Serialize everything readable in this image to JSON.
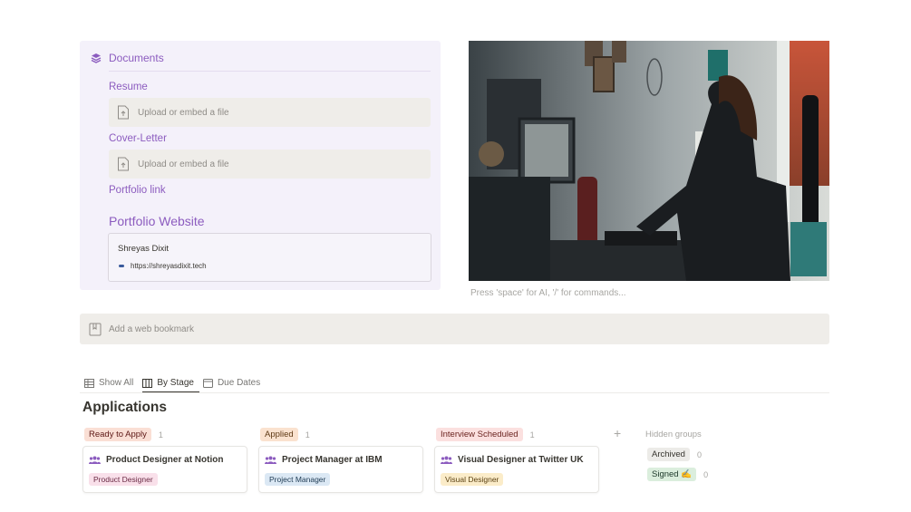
{
  "documents": {
    "title": "Documents",
    "resume_label": "Resume",
    "resume_upload": "Upload or embed a file",
    "cover_label": "Cover-Letter",
    "cover_upload": "Upload or embed a file",
    "portfolio_link_label": "Portfolio link",
    "portfolio_website_title": "Portfolio Website",
    "bookmark_name": "Shreyas Dixit",
    "bookmark_url": "https://shreyasdixit.tech"
  },
  "editor_placeholder": "Press 'space' for AI, '/' for commands...",
  "web_bookmark_placeholder": "Add a web bookmark",
  "views": {
    "tabs": [
      {
        "label": "Show All",
        "icon": "table-icon"
      },
      {
        "label": "By Stage",
        "icon": "board-icon",
        "active": true
      },
      {
        "label": "Due Dates",
        "icon": "calendar-icon"
      }
    ]
  },
  "applications": {
    "title": "Applications",
    "groups": [
      {
        "label": "Ready to Apply",
        "count": "1",
        "tag_bg": "#fadfd5",
        "tag_fg": "#5d1715",
        "card": {
          "title": "Product Designer at Notion",
          "tag": "Product Designer",
          "tag_bg": "#f9e0ea",
          "tag_fg": "#6a2a44"
        }
      },
      {
        "label": "Applied",
        "count": "1",
        "tag_bg": "#fae2cf",
        "tag_fg": "#5f3a15",
        "card": {
          "title": "Project Manager at IBM",
          "tag": "Project Manager",
          "tag_bg": "#dbe8f4",
          "tag_fg": "#213d56"
        }
      },
      {
        "label": "Interview Scheduled",
        "count": "1",
        "tag_bg": "#fbe0df",
        "tag_fg": "#6b2420",
        "card": {
          "title": "Visual Designer at Twitter UK",
          "tag": "Visual Designer",
          "tag_bg": "#fbecc9",
          "tag_fg": "#5c4213"
        }
      }
    ],
    "add_group": "+",
    "hidden_title": "Hidden groups",
    "hidden": [
      {
        "label": "Archived",
        "count": "0",
        "tag_bg": "#ecebe8",
        "tag_fg": "#37352f"
      },
      {
        "label": "Signed ✍️",
        "count": "0",
        "tag_bg": "#dbeedd",
        "tag_fg": "#1c3829"
      }
    ]
  },
  "colors": {
    "accent_purple": "#8c5cbf"
  }
}
